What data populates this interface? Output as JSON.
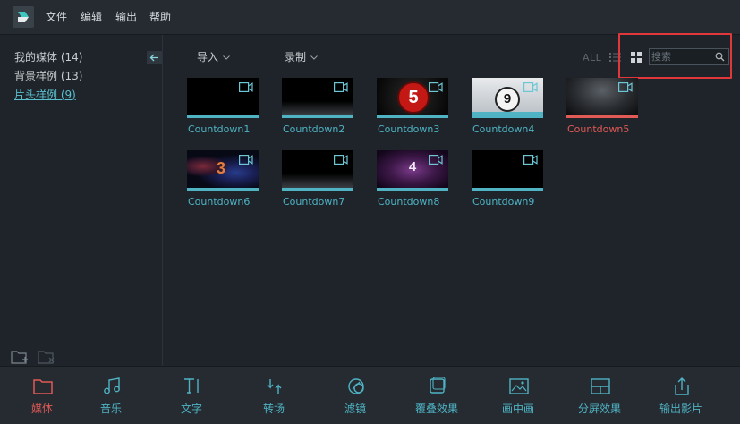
{
  "menu": {
    "items": [
      "文件",
      "编辑",
      "输出",
      "帮助"
    ]
  },
  "sidebar": {
    "items": [
      {
        "label": "我的媒体 (14)"
      },
      {
        "label": "背景样例 (13)"
      },
      {
        "label": "片头样例 (9)"
      }
    ]
  },
  "toolbar": {
    "import_label": "导入",
    "record_label": "录制",
    "all_label": "ALL",
    "search_placeholder": "搜索"
  },
  "media": {
    "items": [
      {
        "name": "Countdown1",
        "thumb": "black"
      },
      {
        "name": "Countdown2",
        "thumb": "black-floor"
      },
      {
        "name": "Countdown3",
        "thumb": "red-5"
      },
      {
        "name": "Countdown4",
        "thumb": "film-9"
      },
      {
        "name": "Countdown5",
        "thumb": "grey-stage",
        "selected": true
      },
      {
        "name": "Countdown6",
        "thumb": "nebula-3"
      },
      {
        "name": "Countdown7",
        "thumb": "black-floor"
      },
      {
        "name": "Countdown8",
        "thumb": "purple-4"
      },
      {
        "name": "Countdown9",
        "thumb": "black"
      }
    ],
    "thumb_text": {
      "red-5": "5",
      "film-9": "9",
      "nebula-3": "3",
      "purple-4": "4"
    }
  },
  "bottom_tabs": [
    {
      "label": "媒体",
      "icon": "folder-icon",
      "active": true
    },
    {
      "label": "音乐",
      "icon": "music-icon"
    },
    {
      "label": "文字",
      "icon": "text-icon"
    },
    {
      "label": "转场",
      "icon": "transition-icon"
    },
    {
      "label": "滤镜",
      "icon": "filter-icon"
    },
    {
      "label": "覆叠效果",
      "icon": "overlay-icon"
    },
    {
      "label": "画中画",
      "icon": "pip-icon"
    },
    {
      "label": "分屏效果",
      "icon": "split-screen-icon"
    },
    {
      "label": "输出影片",
      "icon": "export-icon"
    }
  ],
  "colors": {
    "accent": "#4fb3c4",
    "selected": "#e05a56",
    "highlight": "#e0383a",
    "background": "#1e242a"
  }
}
